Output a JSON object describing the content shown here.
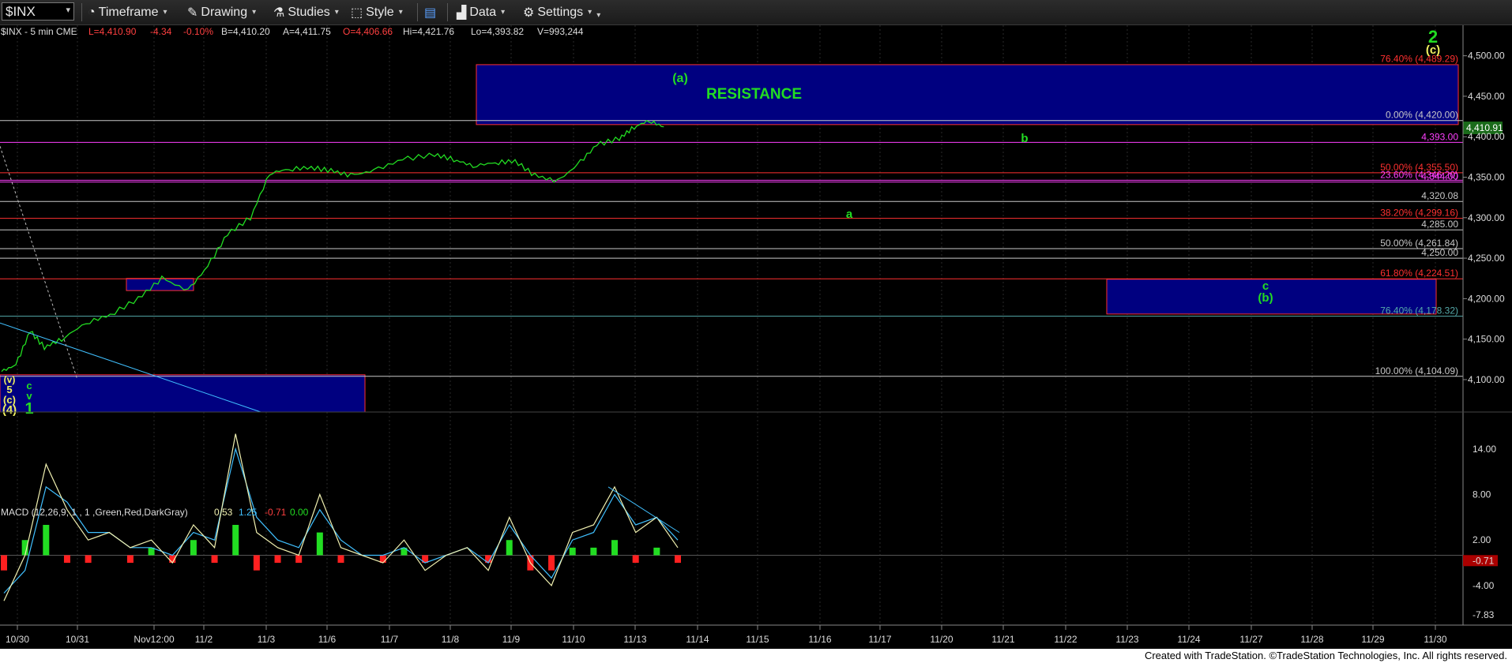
{
  "toolbar": {
    "symbol": "$INX",
    "timeframe": "Timeframe",
    "drawing": "Drawing",
    "studies": "Studies",
    "style": "Style",
    "data": "Data",
    "settings": "Settings"
  },
  "header": {
    "symbol_info": "$INX - 5 min  CME",
    "last": "L=4,410.90",
    "change": "-4.34",
    "change_pct": "-0.10%",
    "bid": "B=4,410.20",
    "ask": "A=4,411.75",
    "open": "O=4,406.66",
    "high": "Hi=4,421.76",
    "low": "Lo=4,393.82",
    "volume": "V=993,244"
  },
  "macd_header": {
    "label": "MACD (12,26,9, 1 , 1 ,Green,Red,DarkGray)",
    "v1": "0.53",
    "v2": "1.25",
    "v3": "-0.71",
    "v4": "0.00"
  },
  "footer": "Created with TradeStation. ©TradeStation Technologies, Inc. All rights reserved.",
  "colors": {
    "price": "#22dd22",
    "macd_line": "#f0f0b0",
    "signal_line": "#40c0ff",
    "hist_pos": "#22dd22",
    "hist_neg": "#ff2020",
    "zone_fill": "#000080",
    "zone_border": "#ff3030",
    "resistance_text": "#22dd22"
  },
  "chart_data": {
    "type": "line",
    "title": "$INX - 5 min",
    "price_axis": {
      "ylim": [
        4060,
        4525
      ],
      "ticks": [
        "4,500.00",
        "4,450.00",
        "4,400.00",
        "4,350.00",
        "4,300.00",
        "4,250.00",
        "4,200.00",
        "4,150.00",
        "4,100.00"
      ]
    },
    "x_ticks": [
      "10/30",
      "10/31",
      "Nov12:00",
      "11/2",
      "11/3",
      "11/6",
      "11/7",
      "11/8",
      "11/9",
      "11/10",
      "11/13",
      "11/14",
      "11/15",
      "11/16",
      "11/17",
      "11/20",
      "11/21",
      "11/22",
      "11/23",
      "11/24",
      "11/27",
      "11/28",
      "11/29",
      "11/30"
    ],
    "price_series": {
      "name": "$INX",
      "x": [
        "10/30",
        "10/30",
        "10/30",
        "10/30",
        "10/31",
        "10/31",
        "10/31",
        "Nov12:00",
        "Nov12:00",
        "11/2",
        "11/2",
        "11/2",
        "11/3",
        "11/3",
        "11/3",
        "11/6",
        "11/6",
        "11/6",
        "11/7",
        "11/7",
        "11/8",
        "11/8",
        "11/8",
        "11/9",
        "11/9",
        "11/9",
        "11/10",
        "11/10",
        "11/10",
        "11/13",
        "11/13",
        "11/13",
        "11/13"
      ],
      "y": [
        4110,
        4118,
        4160,
        4140,
        4150,
        4170,
        4180,
        4200,
        4225,
        4210,
        4240,
        4280,
        4300,
        4355,
        4360,
        4362,
        4358,
        4352,
        4358,
        4372,
        4378,
        4372,
        4364,
        4368,
        4370,
        4352,
        4345,
        4365,
        4390,
        4398,
        4412,
        4420,
        4412
      ]
    },
    "horizontal_levels": [
      {
        "label": "0.00% (4,420.00)",
        "value": 4420.0
      },
      {
        "label": "4,393.00",
        "value": 4393.0
      },
      {
        "label": "50.00% (4,355.50)",
        "value": 4355.5
      },
      {
        "label": "23.60% (4,346.20)",
        "value": 4346.2
      },
      {
        "label": "4,344.00",
        "value": 4344.0
      },
      {
        "label": "4,320.08",
        "value": 4320.08
      },
      {
        "label": "38.20% (4,299.16)",
        "value": 4299.16
      },
      {
        "label": "4,285.00",
        "value": 4285.0
      },
      {
        "label": "50.00% (4,261.84)",
        "value": 4261.84
      },
      {
        "label": "4,250.00",
        "value": 4250.0
      },
      {
        "label": "61.80% (4,224.51)",
        "value": 4224.51
      },
      {
        "label": "76.40% (4,178.32)",
        "value": 4178.32
      },
      {
        "label": "100.00% (4,104.09)",
        "value": 4104.09
      },
      {
        "label": "76.40% (4,489.29)",
        "value": 4489.29
      }
    ],
    "zones": [
      {
        "label": "RESISTANCE",
        "x_start": "11/8",
        "x_end": "11/30",
        "y_low": 4415,
        "y_high": 4489
      },
      {
        "label": "",
        "x_start": "11/22",
        "x_end": "11/29",
        "y_low": 4181,
        "y_high": 4224
      },
      {
        "label": "",
        "x_start": "Nov12:00",
        "x_end": "11/2",
        "y_low": 4210,
        "y_high": 4225
      },
      {
        "label": "",
        "x_start": "10/30",
        "x_end": "11/3",
        "y_low": 4060,
        "y_high": 4106
      }
    ],
    "annotations": [
      {
        "text": "(a)",
        "x": "11/13",
        "y": 4450
      },
      {
        "text": "b",
        "x": "11/21",
        "y": 4383
      },
      {
        "text": "a",
        "x": "11/16",
        "y": 4288
      },
      {
        "text": "c",
        "x": "11/27",
        "y": 4200
      },
      {
        "text": "(b)",
        "x": "11/27",
        "y": 4186
      },
      {
        "text": "2",
        "x": "11/30",
        "y": 4508
      },
      {
        "text": "(c)",
        "x": "11/30",
        "y": 4494
      },
      {
        "text": "(v)",
        "x": "10/30",
        "y": 4093
      },
      {
        "text": "5",
        "x": "10/30",
        "y": 4081
      },
      {
        "text": "(c)",
        "x": "10/30",
        "y": 4069
      },
      {
        "text": "(4)",
        "x": "10/30",
        "y": 4064
      },
      {
        "text": "c",
        "x": "10/30",
        "y": 4085
      },
      {
        "text": "v",
        "x": "10/30",
        "y": 4074
      },
      {
        "text": "1",
        "x": "10/30",
        "y": 4064
      }
    ],
    "macd": {
      "ylim": [
        -9,
        17
      ],
      "ticks": [
        "14.00",
        "8.00",
        "2.00",
        "-0.71",
        "-4.00",
        "-7.83"
      ],
      "macd_line": [
        -6,
        0,
        12,
        6,
        2,
        3,
        1,
        2,
        -1,
        4,
        1,
        16,
        3,
        1,
        0,
        8,
        1,
        0,
        -1,
        2,
        -2,
        0,
        1,
        -2,
        5,
        -1,
        -4,
        3,
        4,
        9,
        3,
        5,
        1
      ],
      "signal_line": [
        -5,
        -2,
        9,
        7,
        3,
        3,
        1,
        1,
        0,
        3,
        2,
        14,
        5,
        2,
        1,
        6,
        2,
        0,
        0,
        1,
        -1,
        0,
        1,
        -1,
        4,
        0,
        -3,
        2,
        3,
        8,
        4,
        5,
        2
      ],
      "histogram": [
        -2,
        2,
        4,
        -1,
        -1,
        0,
        -1,
        1,
        -1,
        2,
        -1,
        4,
        -2,
        -1,
        -1,
        3,
        -1,
        0,
        -1,
        1,
        -1,
        0,
        0,
        -1,
        2,
        -2,
        -2,
        1,
        1,
        2,
        -1,
        1,
        -1
      ]
    }
  }
}
